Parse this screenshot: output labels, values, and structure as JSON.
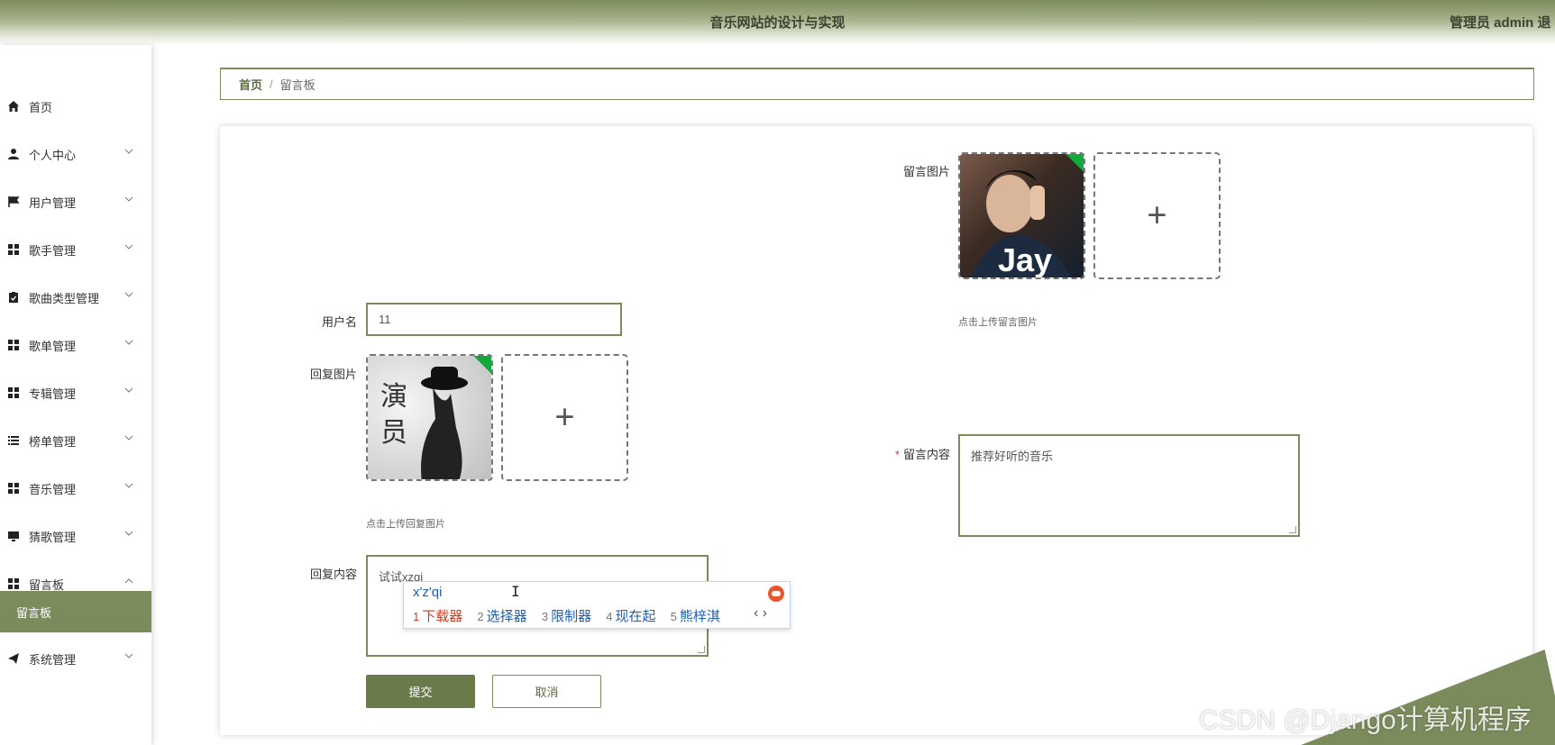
{
  "header": {
    "title": "音乐网站的设计与实现",
    "user": "管理员 admin 退"
  },
  "sidebar": {
    "items": [
      {
        "label": "首页",
        "icon": "home-icon"
      },
      {
        "label": "个人中心",
        "icon": "user-icon"
      },
      {
        "label": "用户管理",
        "icon": "flag-icon"
      },
      {
        "label": "歌手管理",
        "icon": "grid-icon"
      },
      {
        "label": "歌曲类型管理",
        "icon": "clipboard-icon"
      },
      {
        "label": "歌单管理",
        "icon": "grid-icon"
      },
      {
        "label": "专辑管理",
        "icon": "grid-icon"
      },
      {
        "label": "榜单管理",
        "icon": "list-icon"
      },
      {
        "label": "音乐管理",
        "icon": "grid-icon"
      },
      {
        "label": "猜歌管理",
        "icon": "monitor-icon"
      },
      {
        "label": "留言板",
        "icon": "grid-icon"
      },
      {
        "label": "留言板",
        "icon": ""
      },
      {
        "label": "系统管理",
        "icon": "send-icon"
      }
    ]
  },
  "breadcrumb": {
    "home": "首页",
    "sep": "/",
    "current": "留言板"
  },
  "form": {
    "username_label": "用户名",
    "username_value": "11",
    "reply_image_label": "回复图片",
    "reply_image_hint": "点击上传回复图片",
    "reply_content_label": "回复内容",
    "reply_content_value": "试试xzqi",
    "message_image_label": "留言图片",
    "message_image_hint": "点击上传留言图片",
    "message_content_label": "留言内容",
    "message_content_required": "*",
    "message_content_value": "推荐好听的音乐",
    "submit_label": "提交",
    "cancel_label": "取消",
    "plus": "+",
    "art_reply_text": "演员",
    "art_message_text": "Jay"
  },
  "ime": {
    "composition": "x'z'qi",
    "candidates": [
      {
        "n": "1",
        "text": "下载器"
      },
      {
        "n": "2",
        "text": "选择器"
      },
      {
        "n": "3",
        "text": "限制器"
      },
      {
        "n": "4",
        "text": "现在起"
      },
      {
        "n": "5",
        "text": "熊梓淇"
      }
    ],
    "pager": "‹ ›"
  },
  "watermark": "CSDN @Django计算机程序"
}
